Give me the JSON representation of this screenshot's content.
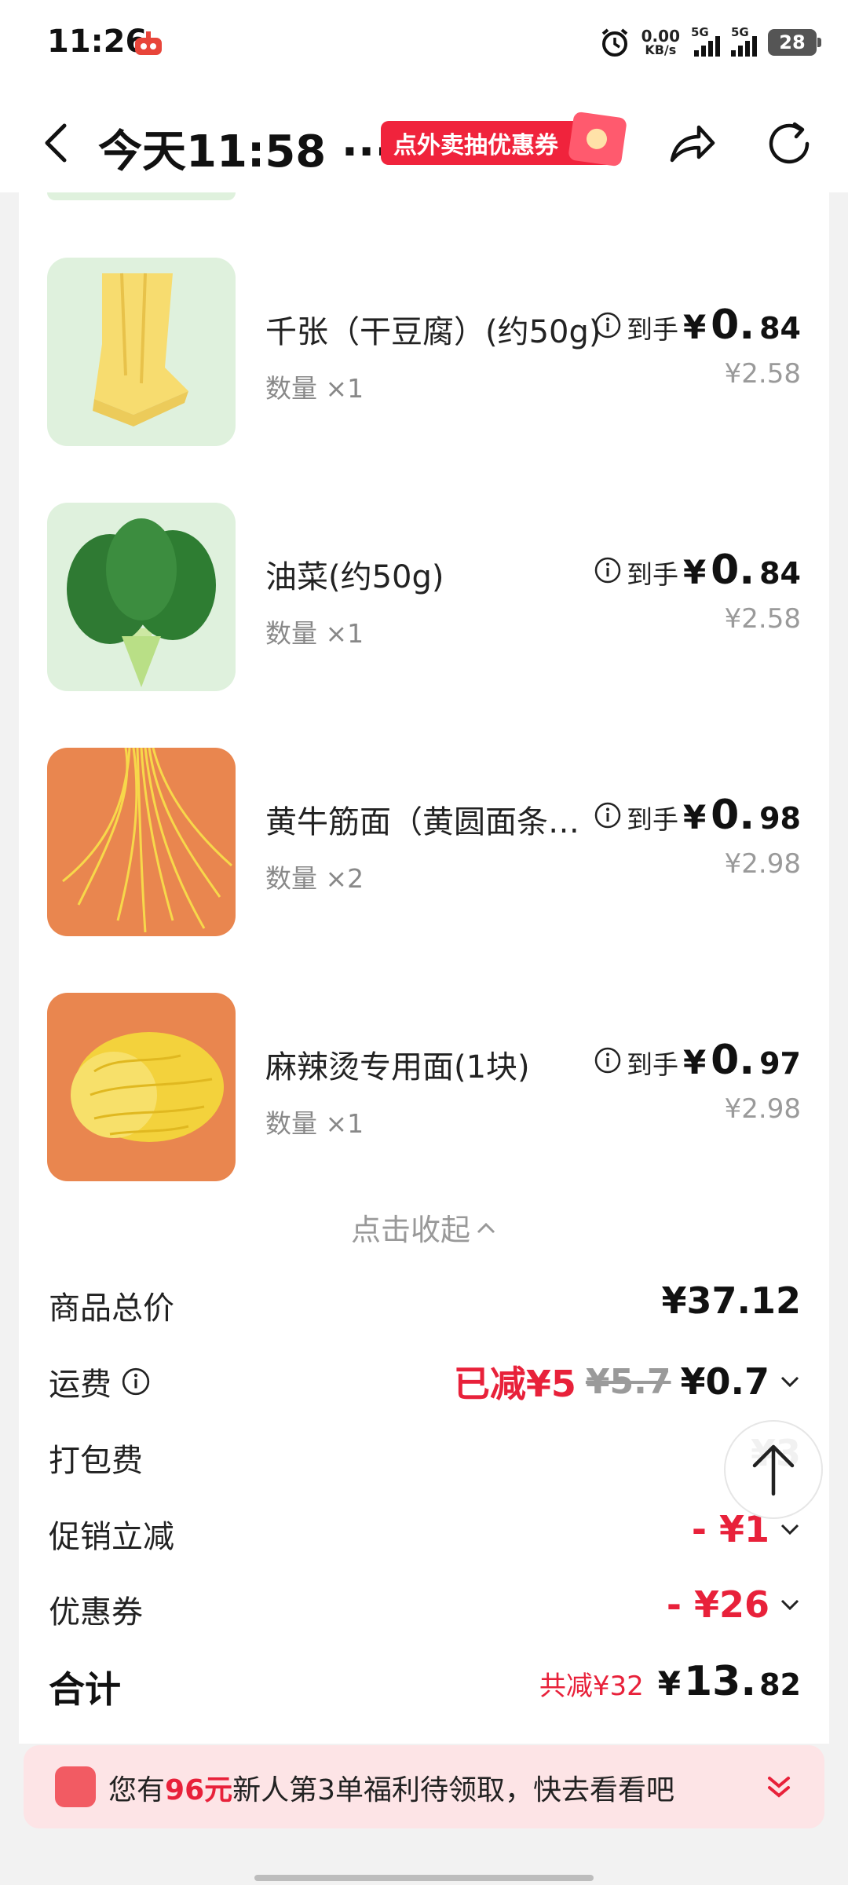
{
  "status_bar": {
    "time": "11:26",
    "net_speed": "0.00",
    "net_unit": "KB/s",
    "sim1": "5G",
    "sim2": "5G",
    "battery": "28"
  },
  "nav": {
    "title": "今天11:58 ···",
    "promo": "点外卖抽优惠券"
  },
  "items": [
    {
      "name": "千张（干豆腐）(约50g)",
      "qty": "数量 ×1",
      "label": "到手",
      "yen": "¥",
      "price_int": "0.",
      "price_dec": "84",
      "original": "¥2.58"
    },
    {
      "name": "油菜(约50g)",
      "qty": "数量 ×1",
      "label": "到手",
      "yen": "¥",
      "price_int": "0.",
      "price_dec": "84",
      "original": "¥2.58"
    },
    {
      "name": "黄牛筋面（黄圆面条…",
      "qty": "数量 ×2",
      "label": "到手",
      "yen": "¥",
      "price_int": "0.",
      "price_dec": "98",
      "original": "¥2.98"
    },
    {
      "name": "麻辣烫专用面(1块)",
      "qty": "数量 ×1",
      "label": "到手",
      "yen": "¥",
      "price_int": "0.",
      "price_dec": "97",
      "original": "¥2.98"
    }
  ],
  "collapse_label": "点击收起",
  "fees": {
    "goods_total": {
      "label": "商品总价",
      "value": "¥37.12"
    },
    "delivery": {
      "label": "运费",
      "discount": "已减¥5",
      "original": "¥5.7",
      "value": "¥0.7"
    },
    "packing": {
      "label": "打包费",
      "value": "¥3"
    },
    "promotion": {
      "label": "促销立减",
      "value": "- ¥1"
    },
    "coupon": {
      "label": "优惠券",
      "value": "- ¥26"
    },
    "total": {
      "label": "合计",
      "saved": "共减¥32",
      "yen": "¥",
      "int": "13.",
      "dec": "82"
    }
  },
  "banner": {
    "prefix": "您有",
    "amount": "96元",
    "suffix": "新人第3单福利待领取，快去看看吧"
  },
  "colors": {
    "accent_red": "#e8213a",
    "banner_bg": "#fde4e6",
    "page_bg": "#f2f2f2"
  }
}
